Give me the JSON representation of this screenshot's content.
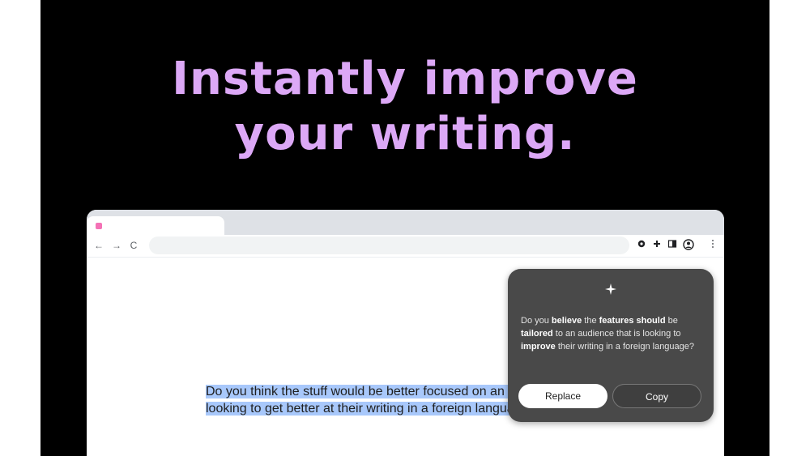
{
  "headline": {
    "line1": "Instantly improve",
    "line2": "your writing."
  },
  "colors": {
    "headline": "#dca8f6",
    "selection": "#a8c8fb",
    "popup_bg": "#494949",
    "favicon": "#f472b6"
  },
  "browser": {
    "nav": {
      "back_icon": "←",
      "forward_icon": "→",
      "reload_icon": "C"
    },
    "toolbar_icons": [
      "settings-icon",
      "extensions-icon",
      "side-panel-icon",
      "profile-icon",
      "menu-icon"
    ]
  },
  "document": {
    "selected_text": "Do you think the stuff would be better focused on an audience that is looking to get better at their writing in a foreign language?"
  },
  "assistant": {
    "icon": "sparkle-icon",
    "suggestion": [
      {
        "text": "Do you ",
        "bold": false
      },
      {
        "text": "believe",
        "bold": true
      },
      {
        "text": " the ",
        "bold": false
      },
      {
        "text": "features should",
        "bold": true
      },
      {
        "text": " be ",
        "bold": false
      },
      {
        "text": "tailored",
        "bold": true
      },
      {
        "text": " to an audience that is looking to ",
        "bold": false
      },
      {
        "text": "improve",
        "bold": true
      },
      {
        "text": " their writing in a foreign language?",
        "bold": false
      }
    ],
    "replace_label": "Replace",
    "copy_label": "Copy"
  }
}
